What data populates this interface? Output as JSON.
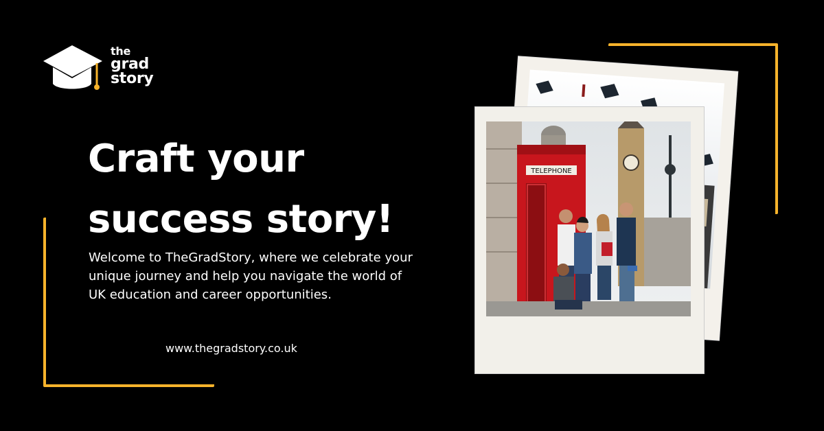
{
  "brand": {
    "line1": "the",
    "line2": "grad",
    "line3": "story"
  },
  "headline": {
    "line1": "Craft your",
    "line2": "success story!"
  },
  "intro": "Welcome to TheGradStory, where we celebrate your unique journey and help you navigate the world of UK education and career opportunities.",
  "website": "www.thegradstory.co.uk",
  "booth_sign": "TELEPHONE",
  "colors": {
    "background": "#000000",
    "accent": "#f7b32b",
    "text": "#ffffff",
    "polaroid": "#f2f0ea"
  }
}
